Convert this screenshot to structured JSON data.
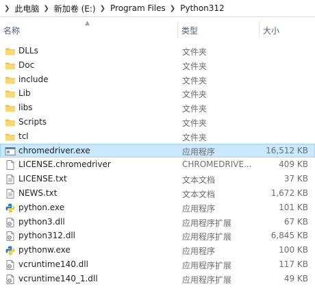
{
  "breadcrumb": {
    "items": [
      "此电脑",
      "新加卷 (E:)",
      "Program Files",
      "Python312"
    ]
  },
  "columns": {
    "name": "名称",
    "type": "类型",
    "size": "大小"
  },
  "files": [
    {
      "name": "DLLs",
      "type": "文件夹",
      "size": "",
      "icon": "folder-icon"
    },
    {
      "name": "Doc",
      "type": "文件夹",
      "size": "",
      "icon": "folder-icon"
    },
    {
      "name": "include",
      "type": "文件夹",
      "size": "",
      "icon": "folder-icon"
    },
    {
      "name": "Lib",
      "type": "文件夹",
      "size": "",
      "icon": "folder-icon"
    },
    {
      "name": "libs",
      "type": "文件夹",
      "size": "",
      "icon": "folder-icon"
    },
    {
      "name": "Scripts",
      "type": "文件夹",
      "size": "",
      "icon": "folder-icon"
    },
    {
      "name": "tcl",
      "type": "文件夹",
      "size": "",
      "icon": "folder-icon"
    },
    {
      "name": "chromedriver.exe",
      "type": "应用程序",
      "size": "16,512 KB",
      "icon": "application-icon",
      "selected": true
    },
    {
      "name": "LICENSE.chromedriver",
      "type": "CHROMEDRIVE...",
      "size": "409 KB",
      "icon": "blank-file-icon"
    },
    {
      "name": "LICENSE.txt",
      "type": "文本文档",
      "size": "37 KB",
      "icon": "text-file-icon"
    },
    {
      "name": "NEWS.txt",
      "type": "文本文档",
      "size": "1,672 KB",
      "icon": "text-file-icon"
    },
    {
      "name": "python.exe",
      "type": "应用程序",
      "size": "101 KB",
      "icon": "python-icon"
    },
    {
      "name": "python3.dll",
      "type": "应用程序扩展",
      "size": "67 KB",
      "icon": "dll-file-icon"
    },
    {
      "name": "python312.dll",
      "type": "应用程序扩展",
      "size": "6,845 KB",
      "icon": "dll-file-icon"
    },
    {
      "name": "pythonw.exe",
      "type": "应用程序",
      "size": "100 KB",
      "icon": "python-icon"
    },
    {
      "name": "vcruntime140.dll",
      "type": "应用程序扩展",
      "size": "117 KB",
      "icon": "dll-file-icon"
    },
    {
      "name": "vcruntime140_1.dll",
      "type": "应用程序扩展",
      "size": "49 KB",
      "icon": "dll-file-icon"
    }
  ],
  "colors": {
    "folder": "#f8d775",
    "selection": "#cce8ff",
    "selection_border": "#99d1ff",
    "header_text": "#4c607a"
  }
}
